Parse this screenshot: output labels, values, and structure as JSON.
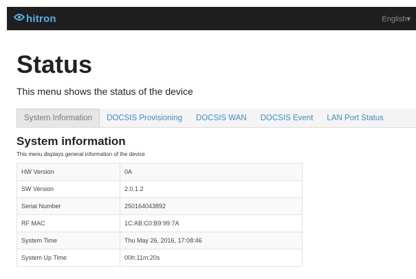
{
  "header": {
    "brand": "hitron",
    "language": "English",
    "language_caret": "▾"
  },
  "page": {
    "title": "Status",
    "description": "This menu shows the status of the device"
  },
  "tabs": [
    {
      "label": "System Information",
      "active": true
    },
    {
      "label": "DOCSIS Provisioning",
      "active": false
    },
    {
      "label": "DOCSIS WAN",
      "active": false
    },
    {
      "label": "DOCSIS Event",
      "active": false
    },
    {
      "label": "LAN Port Status",
      "active": false
    }
  ],
  "section": {
    "title": "System information",
    "description": "This menu displays general information of the device"
  },
  "system_info": [
    {
      "label": "HW Version",
      "value": "0A"
    },
    {
      "label": "SW Version",
      "value": "2.0.1.2"
    },
    {
      "label": "Serial Number",
      "value": "250164043892"
    },
    {
      "label": "RF MAC",
      "value": "1C:AB:C0:B9:99:7A"
    },
    {
      "label": "System Time",
      "value": "Thu May 26, 2016, 17:08:46"
    },
    {
      "label": "System Up Time",
      "value": "00h:11m:20s"
    }
  ],
  "colors": {
    "brand": "#4fb3e6",
    "link": "#3a8ccc",
    "topbar": "#1f1f1f"
  },
  "icons": {
    "logo": "hitron-logo-icon"
  }
}
